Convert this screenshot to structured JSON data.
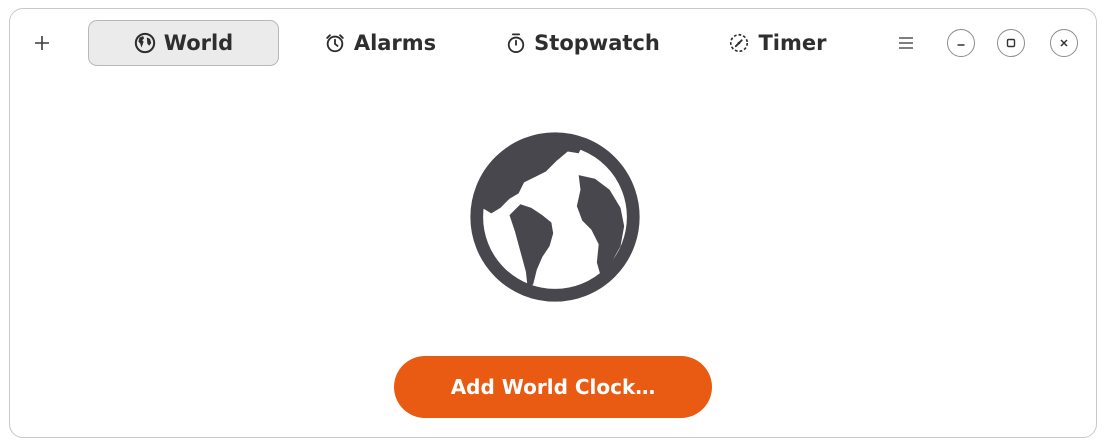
{
  "header": {
    "add_icon": "plus-icon",
    "tabs": [
      {
        "label": "World",
        "icon": "globe-icon",
        "active": true
      },
      {
        "label": "Alarms",
        "icon": "alarm-clock-icon",
        "active": false
      },
      {
        "label": "Stopwatch",
        "icon": "stopwatch-icon",
        "active": false
      },
      {
        "label": "Timer",
        "icon": "timer-icon",
        "active": false
      }
    ],
    "menu_icon": "hamburger-menu-icon",
    "window_controls": [
      "minimize-icon",
      "maximize-icon",
      "close-icon"
    ]
  },
  "main": {
    "illustration_icon": "globe-icon",
    "add_button_label": "Add World Clock…"
  },
  "colors": {
    "accent": "#e95a13",
    "icon_gray": "#48474d",
    "tab_active_bg": "#ebebeb"
  }
}
